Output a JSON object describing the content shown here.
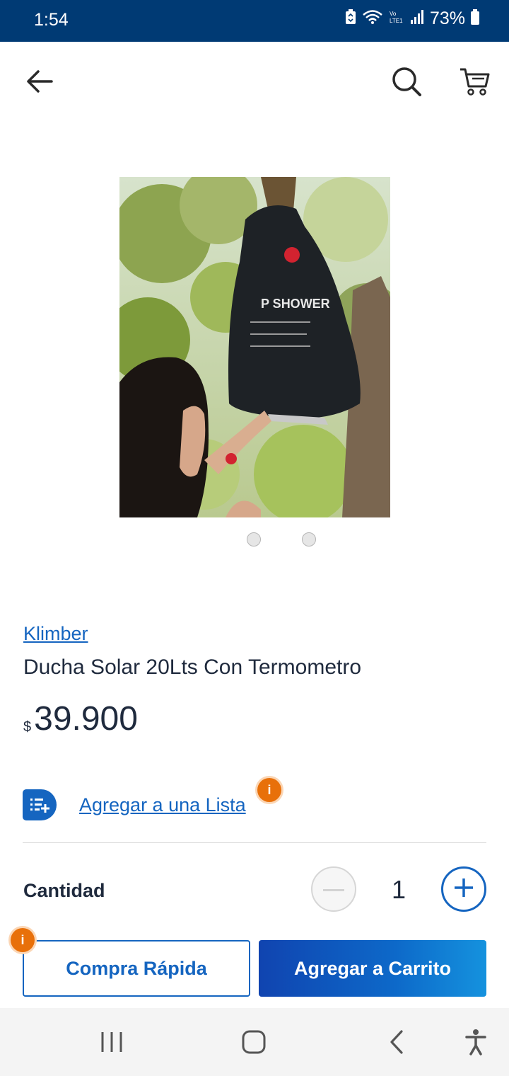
{
  "status_bar": {
    "time": "1:54",
    "battery": "73%",
    "icons": [
      "battery-saver-icon",
      "wifi-icon",
      "volte-icon",
      "signal-icon",
      "battery-icon"
    ],
    "background": "#003a74"
  },
  "header": {
    "back_icon": "arrow-left-icon",
    "search_icon": "search-icon",
    "cart_icon": "cart-icon"
  },
  "gallery": {
    "image_alt": "product-photo-solar-shower-bag",
    "image_text": "P SHOWER",
    "pages": 2
  },
  "product": {
    "brand": "Klimber",
    "title": "Ducha Solar 20Lts Con Termometro",
    "currency": "$",
    "price": "39.900"
  },
  "list": {
    "label": "Agregar a una Lista",
    "info_badge": "i"
  },
  "quantity": {
    "label": "Cantidad",
    "value": "1"
  },
  "actions": {
    "quick_buy_label": "Compra Rápida",
    "quick_buy_badge": "i",
    "add_to_cart_label": "Agregar a Carrito"
  },
  "colors": {
    "accent": "#1565c0",
    "info": "#e8700a"
  },
  "navbar": {
    "icons": [
      "recent-apps-icon",
      "home-icon",
      "back-icon",
      "accessibility-icon"
    ]
  }
}
